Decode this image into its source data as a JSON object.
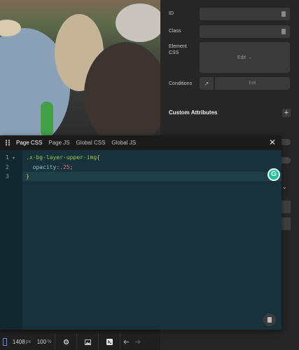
{
  "panel": {
    "id_label": "ID",
    "class_label": "Class",
    "element_css_label": "Element CSS",
    "element_css_edit": "Edit →",
    "conditions_label": "Conditions",
    "conditions_edit": "Edit",
    "custom_attributes_title": "Custom Attributes",
    "add_icon": "+"
  },
  "editor": {
    "tabs": [
      {
        "label": "Page CSS",
        "active": true
      },
      {
        "label": "Page JS",
        "active": false
      },
      {
        "label": "Global CSS",
        "active": false
      },
      {
        "label": "Global JS",
        "active": false
      }
    ],
    "close": "✕",
    "line_numbers": [
      "1",
      "2",
      "3"
    ],
    "code": {
      "line1_selector": ".x-bg-layer-upper-img",
      "line1_brace": "{",
      "line2_prop": "  opacity:",
      "line2_value": ".25",
      "line2_semi": ";",
      "line3": "}"
    }
  },
  "grammarly_letter": "G",
  "bottombar": {
    "width_value": "1408",
    "width_unit": "px",
    "zoom_value": "100",
    "zoom_unit": "%"
  },
  "colors": {
    "editor_bg": "#17323b",
    "selector": "#9fc44a",
    "number": "#e06b8a",
    "grammarly": "#15c39a"
  },
  "icons": [
    "drag-handle-icon",
    "close-icon",
    "database-icon",
    "gear-icon",
    "image-icon",
    "terminal-icon",
    "undo-icon",
    "redo-icon",
    "external-link-icon",
    "grammarly-icon"
  ]
}
